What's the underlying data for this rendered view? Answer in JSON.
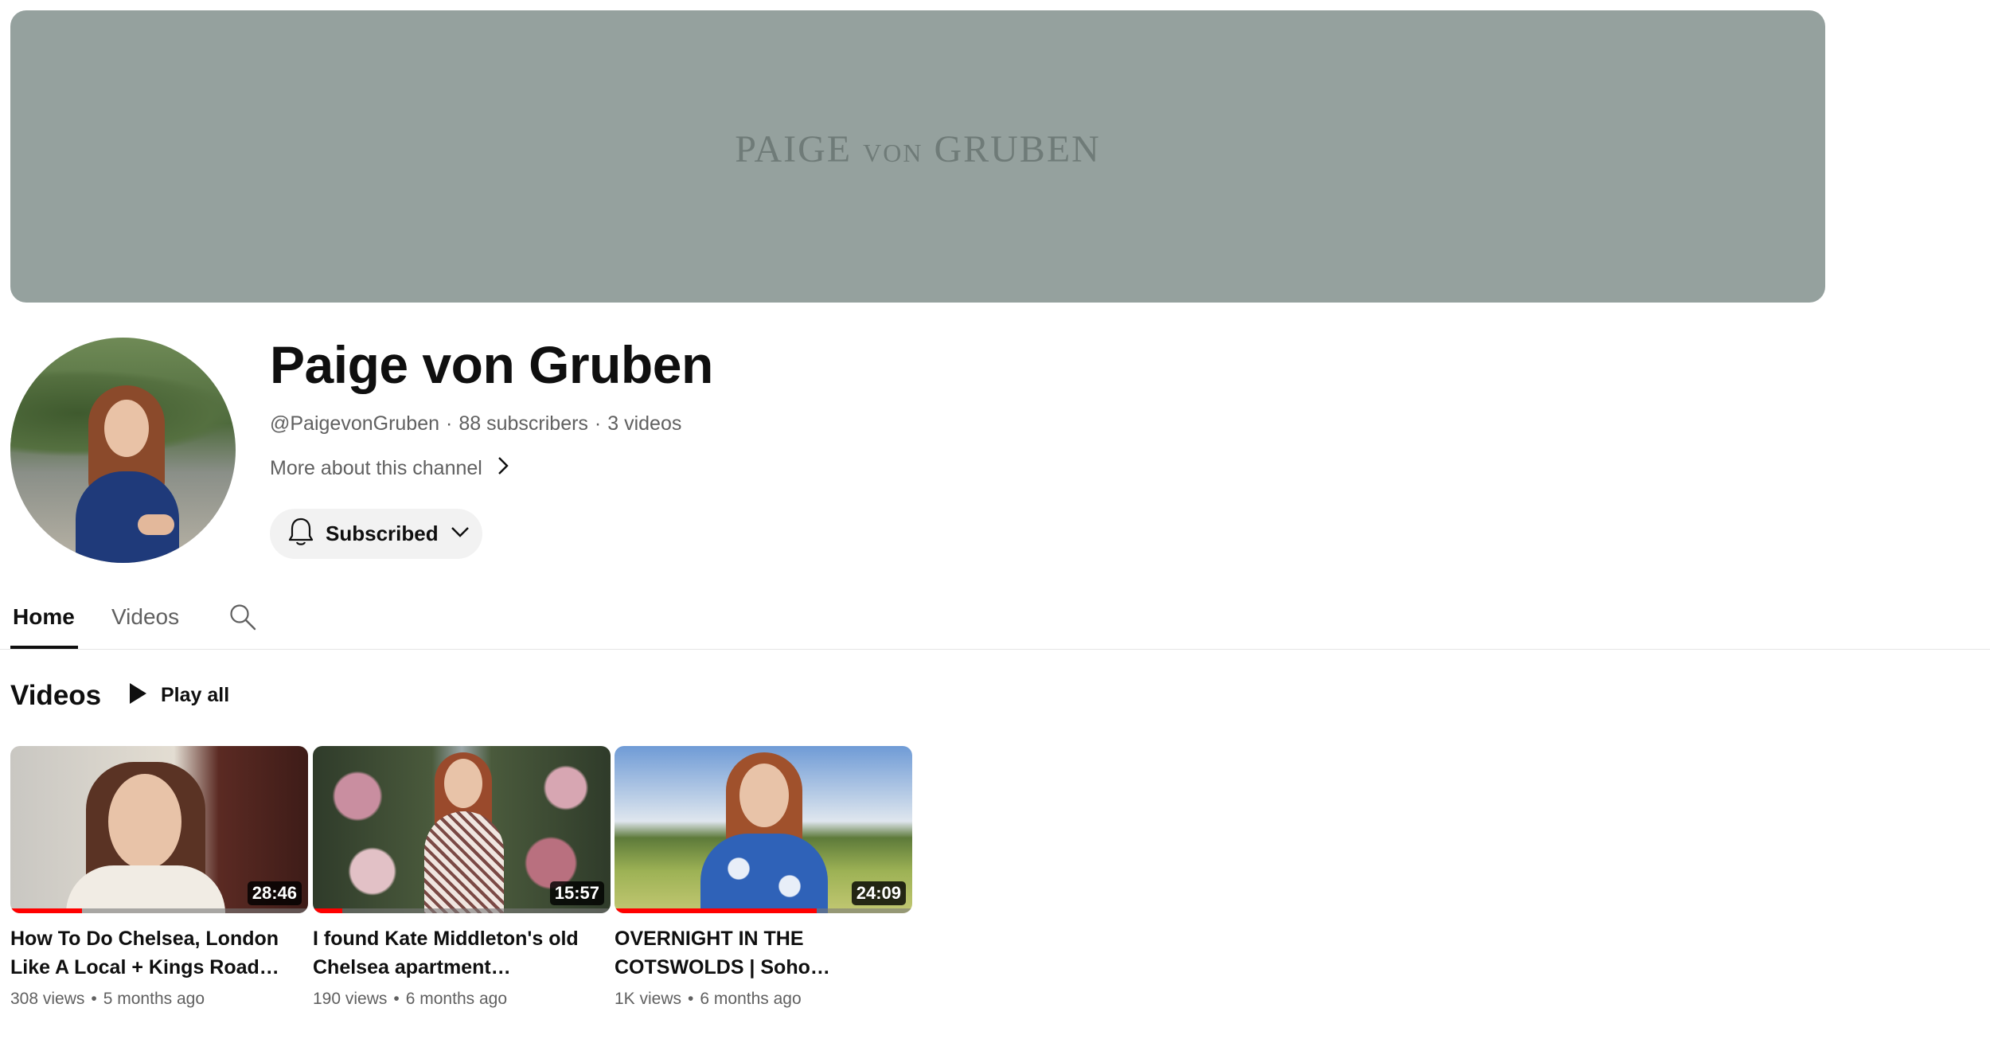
{
  "banner": {
    "logo_left": "PAIGE",
    "logo_mid": "VON",
    "logo_right": "GRUBEN",
    "color": "#95a19e"
  },
  "channel": {
    "name": "Paige von Gruben",
    "handle": "@PaigevonGruben",
    "subscribers": "88 subscribers",
    "videos_count": "3 videos",
    "separator": "·",
    "more_about": "More about this channel"
  },
  "subscribe": {
    "label": "Subscribed",
    "icons": [
      "bell-icon",
      "chevron-down-icon"
    ]
  },
  "tabs": [
    {
      "label": "Home",
      "active": true
    },
    {
      "label": "Videos",
      "active": false
    }
  ],
  "section": {
    "title": "Videos",
    "play_all": "Play all"
  },
  "videos": [
    {
      "title_line1": "How To Do Chelsea, London",
      "title_line2": "Like A Local + Kings Road…",
      "duration": "28:46",
      "views": "308 views",
      "age": "5 months ago",
      "watched_fraction": 0.24
    },
    {
      "title_line1": "I found Kate Middleton's old",
      "title_line2": "Chelsea apartment…",
      "duration": "15:57",
      "views": "190 views",
      "age": "6 months ago",
      "watched_fraction": 0.1
    },
    {
      "title_line1": "OVERNIGHT IN THE",
      "title_line2": "COTSWOLDS | Soho…",
      "duration": "24:09",
      "views": "1K views",
      "age": "6 months ago",
      "watched_fraction": 0.68
    }
  ],
  "colors": {
    "accent_red": "#ff0000",
    "text_primary": "#0f0f0f",
    "text_secondary": "#606060"
  }
}
